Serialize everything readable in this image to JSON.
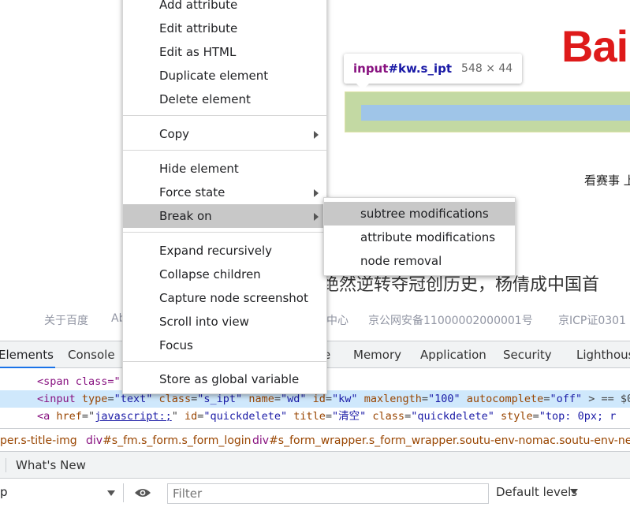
{
  "page": {
    "logo": "Bai",
    "tooltip": {
      "tag": "input",
      "selector": "#kw.s_ipt",
      "dims": "548 × 44"
    },
    "hot_link": "看赛事 上",
    "headline": "绝然逆转夺冠创历史，杨倩成中国首",
    "footer": [
      "关于百度",
      "Ab",
      "中心",
      "京公网安备11000002000001号",
      "京ICP证0301"
    ]
  },
  "devtools": {
    "tabs": [
      "Elements",
      "Console",
      "e",
      "Memory",
      "Application",
      "Security",
      "Lighthouse"
    ],
    "code_lines": {
      "line0": {
        "text": "<span class=\""
      },
      "line1": {
        "tag_open": "<input",
        "a1": "type",
        "v1": "\"text\"",
        "a2": "class",
        "v2": "\"s_ipt\"",
        "a3": "name",
        "v3": "\"wd\"",
        "a4": "id",
        "v4": "\"kw\"",
        "a5": "maxlength",
        "v5": "\"100\"",
        "a6": "autocomplete",
        "v6": "\"off\"",
        "tail": "> == $0"
      },
      "line2": {
        "tag_open": "<a",
        "a1": "href",
        "v1": "javascript:;",
        "a2": "id",
        "v2": "\"quickdelete\"",
        "a3": "title",
        "v3": "\"清空\"",
        "a4": "class",
        "v4": "\"quickdelete\"",
        "a5": "style",
        "v5": "\"top: 0px; r"
      }
    },
    "breadcrumbs": [
      {
        "tag": "",
        "cls": "per.s-title-img"
      },
      {
        "tag": "div",
        "cls": "#s_fm.s_form.s_form_login"
      },
      {
        "tag": "div",
        "cls": "#s_form_wrapper.s_form_wrapper.soutu-env-nomac.soutu-env-newind"
      }
    ],
    "drawer_tab": "What's New",
    "console": {
      "context": "p",
      "filter_placeholder": "Filter",
      "levels": "Default levels"
    }
  },
  "context_menu": {
    "items": [
      "Add attribute",
      "Edit attribute",
      "Edit as HTML",
      "Duplicate element",
      "Delete element",
      "Copy",
      "Hide element",
      "Force state",
      "Break on",
      "Expand recursively",
      "Collapse children",
      "Capture node screenshot",
      "Scroll into view",
      "Focus",
      "Store as global variable"
    ]
  },
  "submenu": {
    "items": [
      "subtree modifications",
      "attribute modifications",
      "node removal"
    ]
  }
}
